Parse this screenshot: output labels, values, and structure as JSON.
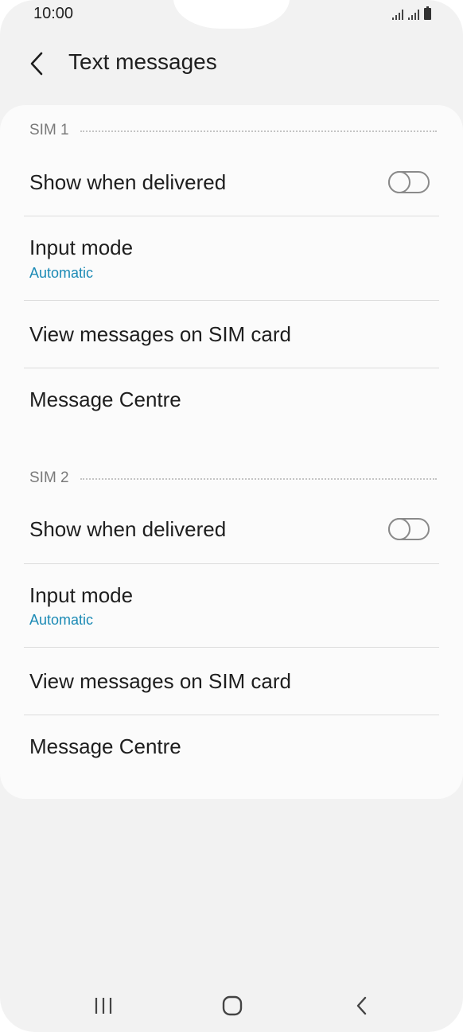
{
  "status_bar": {
    "time": "10:00"
  },
  "header": {
    "title": "Text messages",
    "back_icon": "chevron-left-icon"
  },
  "sim1": {
    "label": "SIM 1",
    "show_delivered": {
      "label": "Show when delivered",
      "enabled": false
    },
    "input_mode": {
      "label": "Input mode",
      "value": "Automatic"
    },
    "view_messages": {
      "label": "View messages on SIM card"
    },
    "message_centre": {
      "label": "Message Centre"
    }
  },
  "sim2": {
    "label": "SIM 2",
    "show_delivered": {
      "label": "Show when delivered",
      "enabled": false
    },
    "input_mode": {
      "label": "Input mode",
      "value": "Automatic"
    },
    "view_messages": {
      "label": "View messages on SIM card"
    },
    "message_centre": {
      "label": "Message Centre"
    }
  },
  "navigation_bar": {
    "recents_icon": "recent-apps-icon",
    "home_icon": "home-icon",
    "back_icon": "back-icon"
  },
  "colors": {
    "accent": "#1b8ab5",
    "background": "#f2f2f2",
    "card": "#fbfbfb"
  }
}
